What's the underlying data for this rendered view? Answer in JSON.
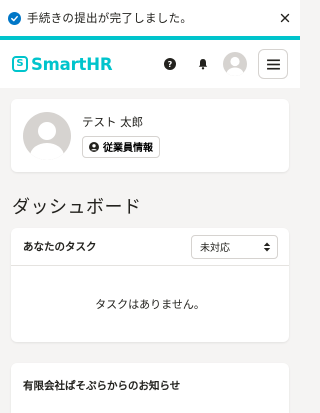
{
  "toast": {
    "message": "手続きの提出が完了しました。",
    "icon": "check-circle-icon",
    "close_icon": "close-icon"
  },
  "header": {
    "logo_mark": "S",
    "logo_text": "SmartHR",
    "help_icon_glyph": "?",
    "brand_color": "#00c4cc"
  },
  "profile": {
    "name": "テスト 太郎",
    "employee_info_label": "従業員情報"
  },
  "page_title": "ダッシュボード",
  "tasks": {
    "title": "あなたのタスク",
    "filter_selected": "未対応",
    "empty_message": "タスクはありません。"
  },
  "notices": {
    "title": "有限会社ぱそぷらからのお知らせ"
  }
}
